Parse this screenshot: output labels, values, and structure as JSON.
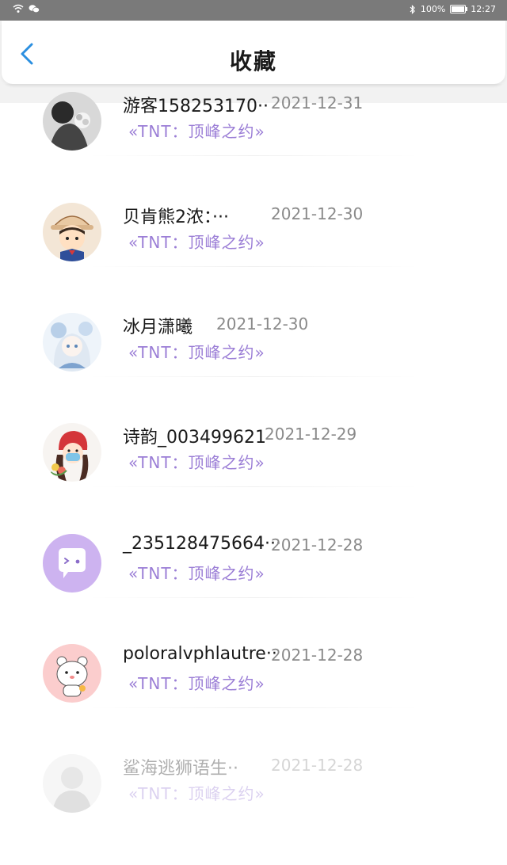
{
  "status": {
    "battery": "100%",
    "time": "12:27"
  },
  "header": {
    "title": "收藏"
  },
  "items": [
    {
      "name": "游客158253170··",
      "date": "2021-12-31",
      "book": "«TNT：顶峰之约»",
      "avatar": "photo-avatar"
    },
    {
      "name": "贝肯熊2浓：···",
      "date": "2021-12-30",
      "book": "«TNT：顶峰之约»",
      "avatar": "cartoon-boy-avatar"
    },
    {
      "name": "冰月潇曦",
      "date": "2021-12-30",
      "book": "«TNT：顶峰之约»",
      "avatar": "anime-girl-avatar"
    },
    {
      "name": "诗韵_003499621",
      "date": "2021-12-29",
      "book": "«TNT：顶峰之约»",
      "avatar": "red-hood-girl-avatar"
    },
    {
      "name": "_235128475664···",
      "date": "2021-12-28",
      "book": "«TNT：顶峰之约»",
      "avatar": "chat-bubble-avatar"
    },
    {
      "name": "poloralvphlautre··",
      "date": "2021-12-28",
      "book": "«TNT：顶峰之约»",
      "avatar": "bear-avatar"
    },
    {
      "name": "鲨海逃狮语生··",
      "date": "2021-12-28",
      "book": "«TNT：顶峰之约»",
      "avatar": "sketch-avatar"
    }
  ],
  "colors": {
    "accent": "#2b8fe0",
    "book_title": "#9b7ed6",
    "date": "#8a8a8a"
  }
}
